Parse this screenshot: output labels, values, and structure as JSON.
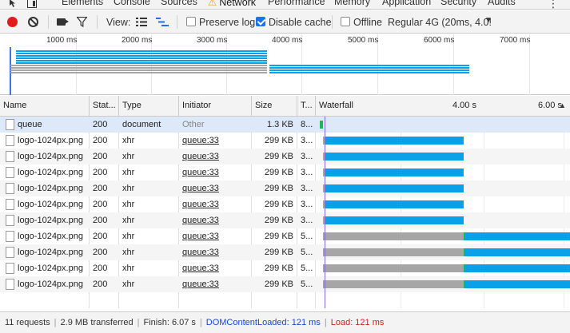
{
  "tabs": [
    {
      "label": "Elements"
    },
    {
      "label": "Console"
    },
    {
      "label": "Sources"
    },
    {
      "label": "Network",
      "active": true,
      "warning": true
    },
    {
      "label": "Performance"
    },
    {
      "label": "Memory"
    },
    {
      "label": "Application"
    },
    {
      "label": "Security"
    },
    {
      "label": "Audits"
    }
  ],
  "toolbar": {
    "view_label": "View:",
    "preserve_log": "Preserve log",
    "preserve_log_checked": false,
    "disable_cache": "Disable cache",
    "disable_cache_checked": true,
    "offline": "Offline",
    "offline_checked": false,
    "throttling": "Regular 4G (20ms, 4.0!"
  },
  "overview": {
    "tick_labels": [
      "1000 ms",
      "2000 ms",
      "3000 ms",
      "4000 ms",
      "5000 ms",
      "6000 ms",
      "7000 ms"
    ]
  },
  "columns": {
    "name": "Name",
    "status": "Stat...",
    "type": "Type",
    "initiator": "Initiator",
    "size": "Size",
    "time": "T...",
    "waterfall": "Waterfall",
    "wf_tick_1": "4.00 s",
    "wf_tick_2": "6.00 s"
  },
  "requests": [
    {
      "name": "queue",
      "status": "200",
      "type": "document",
      "initiator": "Other",
      "initiator_link": false,
      "size": "1.3 KB",
      "time": "8...",
      "wait_end_s": 0.0,
      "start_s": 0.0,
      "end_s": 0.03
    },
    {
      "name": "logo-1024px.png",
      "status": "200",
      "type": "xhr",
      "initiator": "queue:33",
      "initiator_link": true,
      "size": "299 KB",
      "time": "3...",
      "wait_end_s": 0.04,
      "start_s": 0.07,
      "end_s": 3.4
    },
    {
      "name": "logo-1024px.png",
      "status": "200",
      "type": "xhr",
      "initiator": "queue:33",
      "initiator_link": true,
      "size": "299 KB",
      "time": "3...",
      "wait_end_s": 0.04,
      "start_s": 0.07,
      "end_s": 3.4
    },
    {
      "name": "logo-1024px.png",
      "status": "200",
      "type": "xhr",
      "initiator": "queue:33",
      "initiator_link": true,
      "size": "299 KB",
      "time": "3...",
      "wait_end_s": 0.04,
      "start_s": 0.07,
      "end_s": 3.4
    },
    {
      "name": "logo-1024px.png",
      "status": "200",
      "type": "xhr",
      "initiator": "queue:33",
      "initiator_link": true,
      "size": "299 KB",
      "time": "3...",
      "wait_end_s": 0.04,
      "start_s": 0.07,
      "end_s": 3.4
    },
    {
      "name": "logo-1024px.png",
      "status": "200",
      "type": "xhr",
      "initiator": "queue:33",
      "initiator_link": true,
      "size": "299 KB",
      "time": "3...",
      "wait_end_s": 0.04,
      "start_s": 0.07,
      "end_s": 3.4
    },
    {
      "name": "logo-1024px.png",
      "status": "200",
      "type": "xhr",
      "initiator": "queue:33",
      "initiator_link": true,
      "size": "299 KB",
      "time": "3...",
      "wait_end_s": 0.04,
      "start_s": 0.07,
      "end_s": 3.4
    },
    {
      "name": "logo-1024px.png",
      "status": "200",
      "type": "xhr",
      "initiator": "queue:33",
      "initiator_link": true,
      "size": "299 KB",
      "time": "5...",
      "wait_end_s": 3.4,
      "start_s": 3.43,
      "end_s": 6.07
    },
    {
      "name": "logo-1024px.png",
      "status": "200",
      "type": "xhr",
      "initiator": "queue:33",
      "initiator_link": true,
      "size": "299 KB",
      "time": "5...",
      "wait_end_s": 3.4,
      "start_s": 3.43,
      "end_s": 6.07
    },
    {
      "name": "logo-1024px.png",
      "status": "200",
      "type": "xhr",
      "initiator": "queue:33",
      "initiator_link": true,
      "size": "299 KB",
      "time": "5...",
      "wait_end_s": 3.4,
      "start_s": 3.43,
      "end_s": 6.07
    },
    {
      "name": "logo-1024px.png",
      "status": "200",
      "type": "xhr",
      "initiator": "queue:33",
      "initiator_link": true,
      "size": "299 KB",
      "time": "5...",
      "wait_end_s": 3.4,
      "start_s": 3.43,
      "end_s": 6.07
    }
  ],
  "footer": {
    "requests": "11 requests",
    "transferred": "2.9 MB transferred",
    "finish": "Finish: 6.07 s",
    "dcl": "DOMContentLoaded: 121 ms",
    "load": "Load: 121 ms"
  },
  "colors": {
    "accent": "#1a73e8",
    "waterfall_waiting": "#a6a6a6",
    "waterfall_ttfb": "#1fb653",
    "waterfall_download": "#0aa1e8",
    "dcl": "#1a47d6",
    "load": "#d21c1c"
  }
}
